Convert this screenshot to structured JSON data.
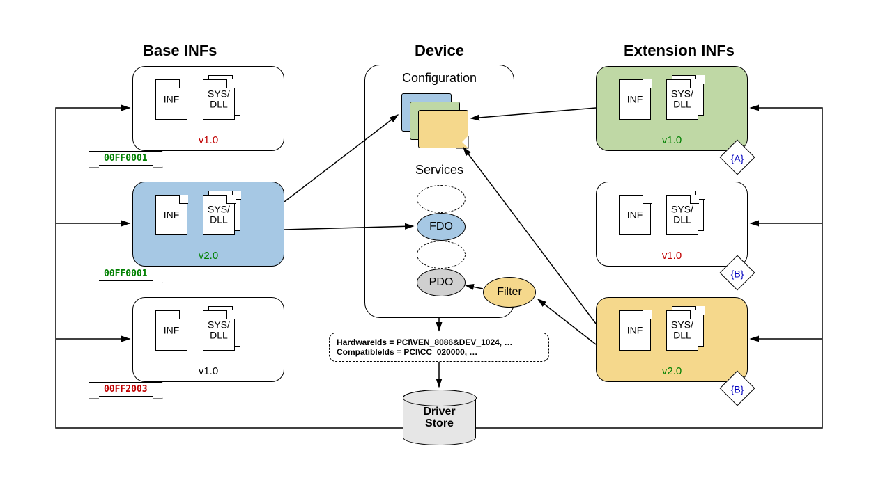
{
  "headers": {
    "base": "Base INFs",
    "device": "Device",
    "ext": "Extension INFs"
  },
  "labels": {
    "inf": "INF",
    "sysdll": "SYS/\nDLL"
  },
  "base": {
    "p1": {
      "version": "v1.0",
      "vclass": "red",
      "banner": "00FF0001",
      "bclass": "green-text"
    },
    "p2": {
      "version": "v2.0",
      "vclass": "green",
      "banner": "00FF0001",
      "bclass": "green-text"
    },
    "p3": {
      "version": "v1.0",
      "vclass": "black",
      "banner": "00FF2003",
      "bclass": "red-text"
    }
  },
  "ext": {
    "p1": {
      "version": "v1.0",
      "vclass": "green",
      "diamond": "{A}"
    },
    "p2": {
      "version": "v1.0",
      "vclass": "red",
      "diamond": "{B}"
    },
    "p3": {
      "version": "v2.0",
      "vclass": "green",
      "diamond": "{B}"
    }
  },
  "device": {
    "config": "Configuration",
    "services": "Services",
    "fdo": "FDO",
    "pdo": "PDO",
    "filter": "Filter",
    "ids_line1": "HardwareIds = PCI\\VEN_8086&DEV_1024, …",
    "ids_line2": "CompatibleIds = PCI\\CC_020000, …",
    "store": "Driver\nStore"
  }
}
